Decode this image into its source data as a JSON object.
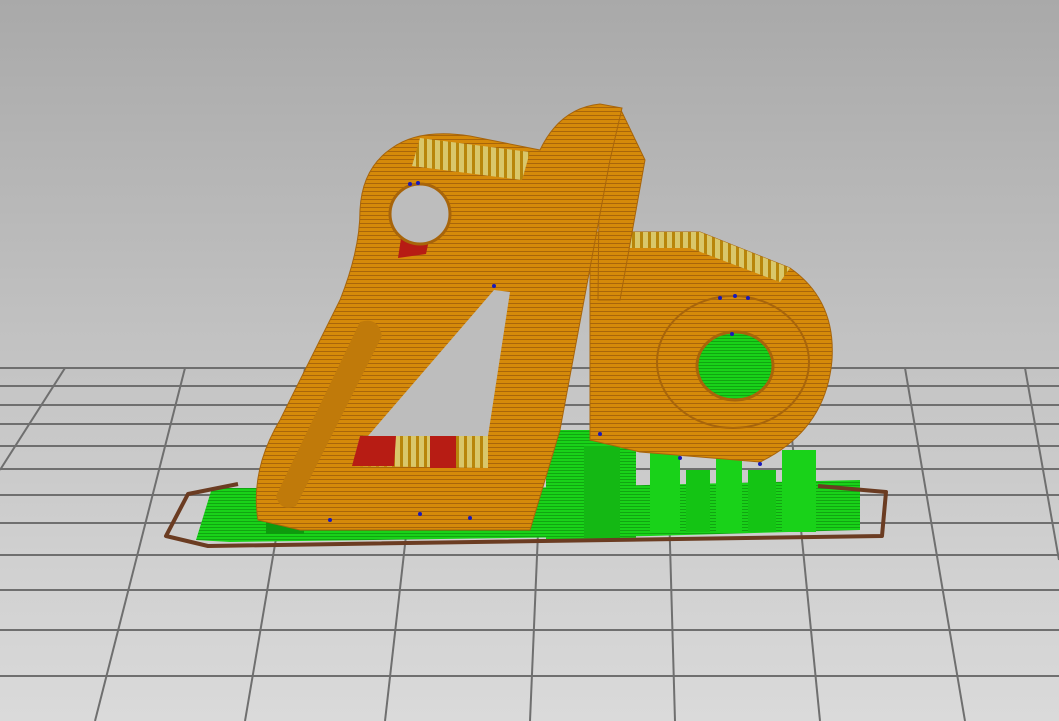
{
  "app": {
    "view": "gcode-preview",
    "colors": {
      "background_top": "#a9a9a9",
      "background_bottom": "#dadada",
      "bed_grid": "#6f6f6f",
      "perimeter": "#d58a0a",
      "perimeter_dark": "#a8650a",
      "solid_infill": "#b71c14",
      "top_solid_infill": "#d9c76a",
      "support_material": "#19d219",
      "support_dark": "#0e9a0e",
      "skirt": "#6b3c22",
      "overhang_perimeter": "#1a1ab8"
    }
  },
  "scene": {
    "bed": {
      "grid": true
    },
    "object": {
      "name": "",
      "feature_types": [
        "perimeter",
        "solid_infill",
        "top_solid_infill",
        "support_material",
        "skirt",
        "overhang_perimeter"
      ]
    }
  }
}
